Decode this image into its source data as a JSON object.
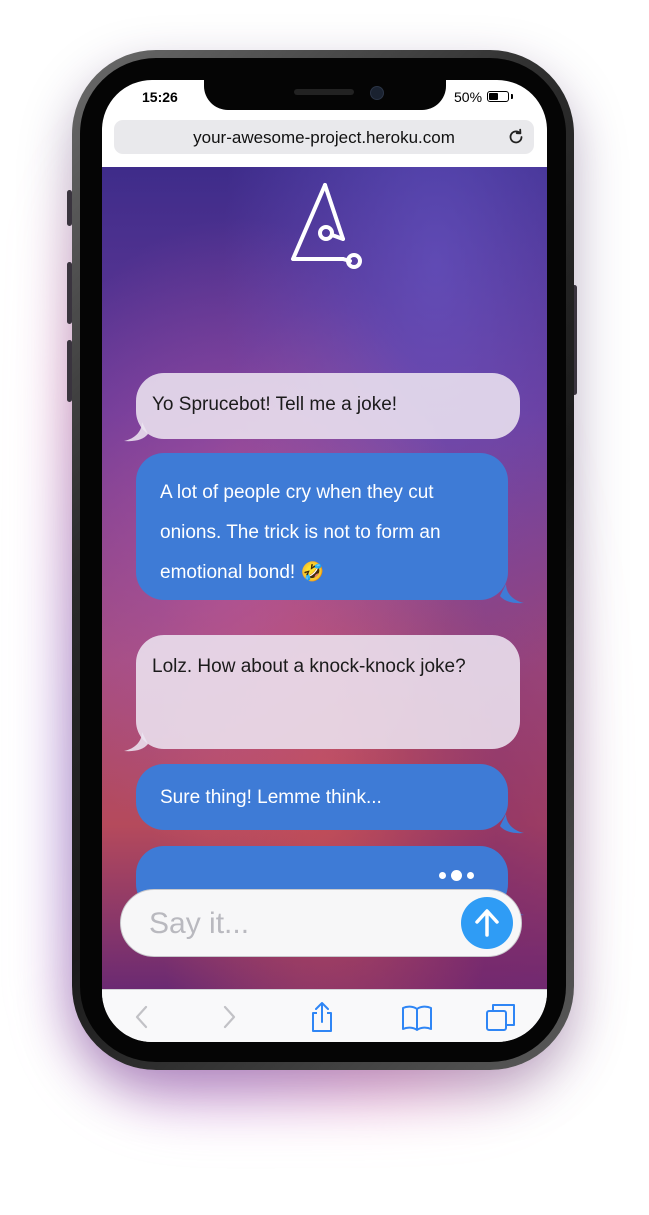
{
  "status_bar": {
    "time": "15:26",
    "battery_text": "50%",
    "battery_level": 0.5
  },
  "browser": {
    "url": "your-awesome-project.heroku.com",
    "reload_icon": "reload-icon"
  },
  "app": {
    "logo_icon": "sprucebot-logo-icon",
    "messages": [
      {
        "sender": "user",
        "text": "Yo Sprucebot!  Tell me a joke!"
      },
      {
        "sender": "bot",
        "text": "A lot of people cry when they cut onions. The trick is not to form an emotional bond! 🤣"
      },
      {
        "sender": "user",
        "text": "Lolz. How about a knock-knock joke?"
      },
      {
        "sender": "bot",
        "text": "Sure thing! Lemme think..."
      },
      {
        "sender": "bot",
        "typing": true
      }
    ],
    "composer": {
      "placeholder": "Say it...",
      "value": "",
      "send_icon": "arrow-up-icon"
    }
  },
  "toolbar": {
    "icons": [
      "back-icon",
      "forward-icon",
      "share-icon",
      "bookmarks-icon",
      "tabs-icon"
    ]
  },
  "colors": {
    "bot_bubble": "#3e7bd6",
    "user_bubble": "#ece4f0",
    "send_button": "#2f9cf5",
    "toolbar_icon": "#2f86f5"
  }
}
